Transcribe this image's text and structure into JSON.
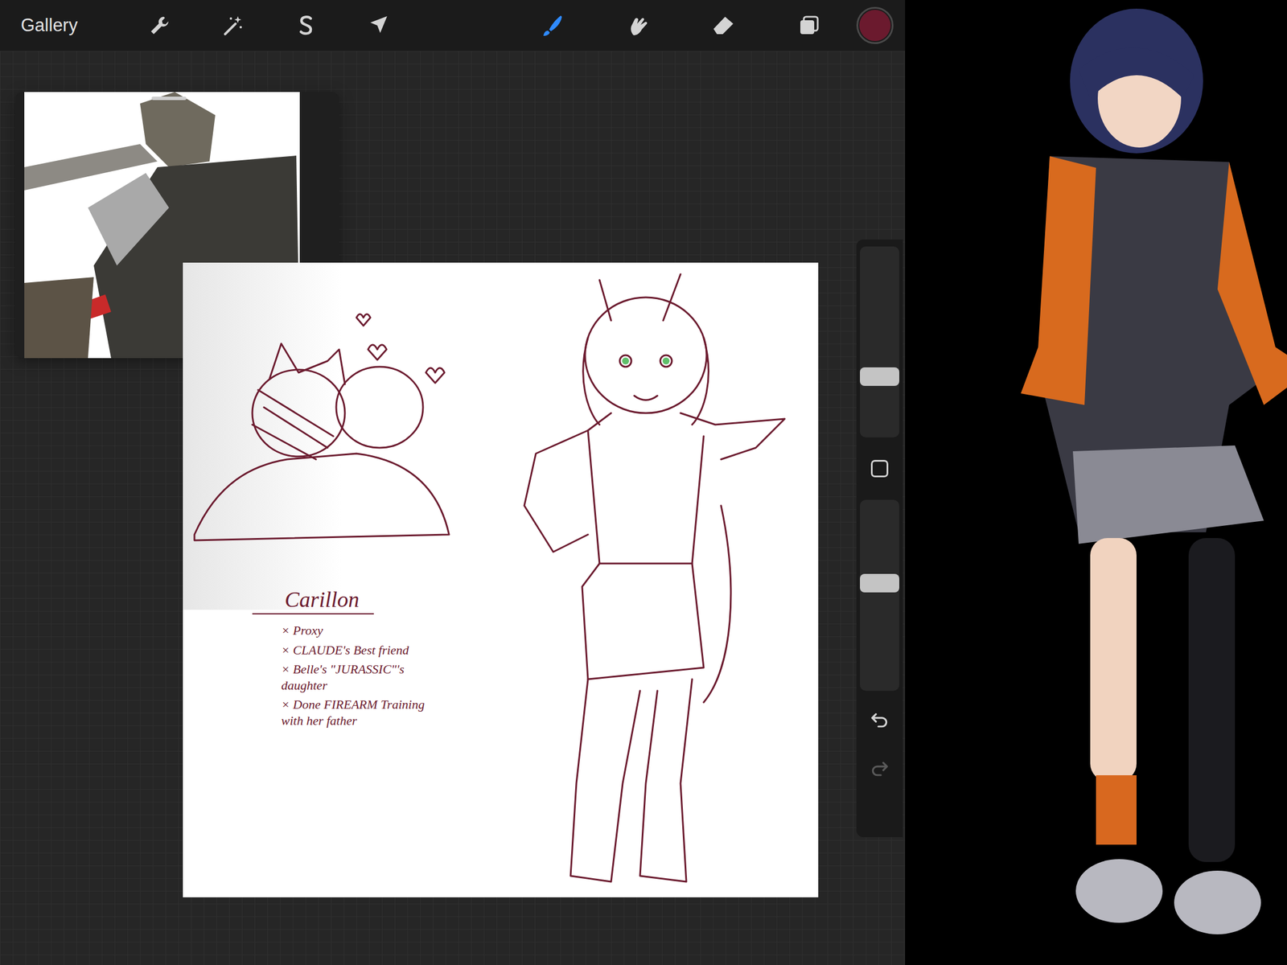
{
  "toolbar": {
    "gallery": "Gallery",
    "left_tools": [
      {
        "kind": "wrench",
        "selected": false
      },
      {
        "kind": "wand",
        "selected": false
      },
      {
        "kind": "selection",
        "selected": false
      },
      {
        "kind": "transform",
        "selected": false
      }
    ],
    "right_tools": [
      {
        "kind": "brush",
        "selected": true
      },
      {
        "kind": "smudge",
        "selected": false
      },
      {
        "kind": "eraser",
        "selected": false
      },
      {
        "kind": "layers",
        "selected": false
      }
    ],
    "color": "#6b1a2e"
  },
  "sidebar": {
    "brush_size": {
      "level": 0.3
    },
    "opacity": {
      "level": 0.57
    },
    "undo": {
      "disabled": false
    },
    "redo": {
      "disabled": true
    }
  },
  "canvas": {
    "title": "Carillon",
    "notes": [
      "× Proxy",
      "× CLAUDE's Best friend",
      "× Belle's \"JURASSIC\"'s daughter",
      "× Done FIREARM Training with her father"
    ]
  }
}
